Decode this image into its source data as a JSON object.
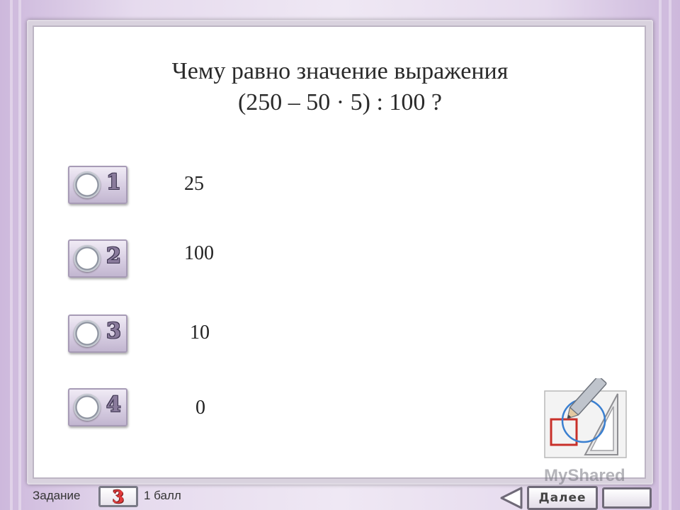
{
  "question": {
    "line1": "Чему равно значение выражения",
    "line2": "(250 – 50 · 5) : 100 ?"
  },
  "options": [
    {
      "number": "1",
      "answer": "25"
    },
    {
      "number": "2",
      "answer": "100"
    },
    {
      "number": "3",
      "answer": "10"
    },
    {
      "number": "4",
      "answer": "0"
    }
  ],
  "footer": {
    "task_label": "Задание",
    "task_number": "3",
    "points": "1 балл",
    "next_label": "Далее"
  },
  "watermark": "MyShared",
  "colors": {
    "task_number": "#e23b3b",
    "option_number": "#8a7b9c",
    "background": "#e6dbee"
  }
}
